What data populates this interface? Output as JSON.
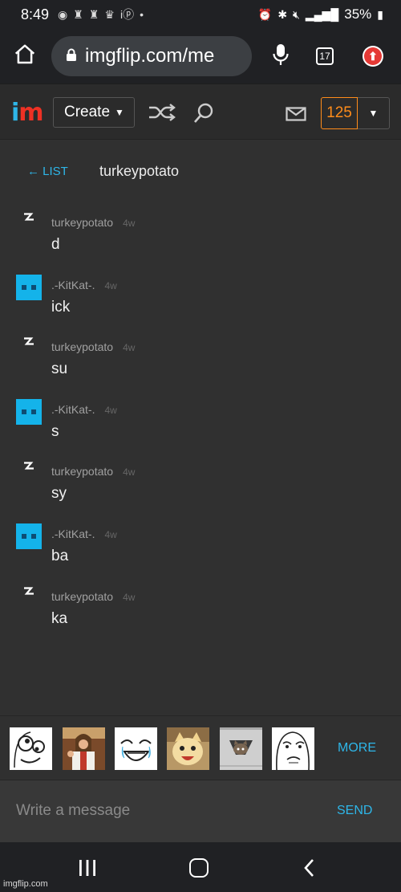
{
  "statusbar": {
    "time": "8:49",
    "battery": "35%"
  },
  "browser": {
    "url": "imgflip.com/me",
    "tab_count": "17"
  },
  "nav": {
    "create_label": "Create",
    "points": "125"
  },
  "chat": {
    "back_label": "← LIST",
    "title": "turkeypotato"
  },
  "messages": [
    {
      "user": "turkeypotato",
      "avatar": "lightning-icon",
      "time": "4w",
      "text": "d"
    },
    {
      "user": ".-KitKat-.",
      "avatar": "blue-block-avatar",
      "time": "4w",
      "text": "ick"
    },
    {
      "user": "turkeypotato",
      "avatar": "lightning-icon",
      "time": "4w",
      "text": "su"
    },
    {
      "user": ".-KitKat-.",
      "avatar": "blue-block-avatar",
      "time": "4w",
      "text": "s"
    },
    {
      "user": "turkeypotato",
      "avatar": "lightning-icon",
      "time": "4w",
      "text": "sy"
    },
    {
      "user": ".-KitKat-.",
      "avatar": "blue-block-avatar",
      "time": "4w",
      "text": "ba"
    },
    {
      "user": "turkeypotato",
      "avatar": "lightning-icon",
      "time": "4w",
      "text": "ka"
    }
  ],
  "memes": {
    "items": [
      "derp-face",
      "buddy-christ",
      "happy-tears-face",
      "happy-cat",
      "ceiling-cat",
      "okay-face"
    ],
    "more_label": "MORE"
  },
  "composer": {
    "placeholder": "Write a message",
    "send_label": "SEND"
  },
  "watermark": "imgflip.com",
  "colors": {
    "accent": "#2eb6e8",
    "points": "#ff8c1a",
    "background": "#303030"
  }
}
